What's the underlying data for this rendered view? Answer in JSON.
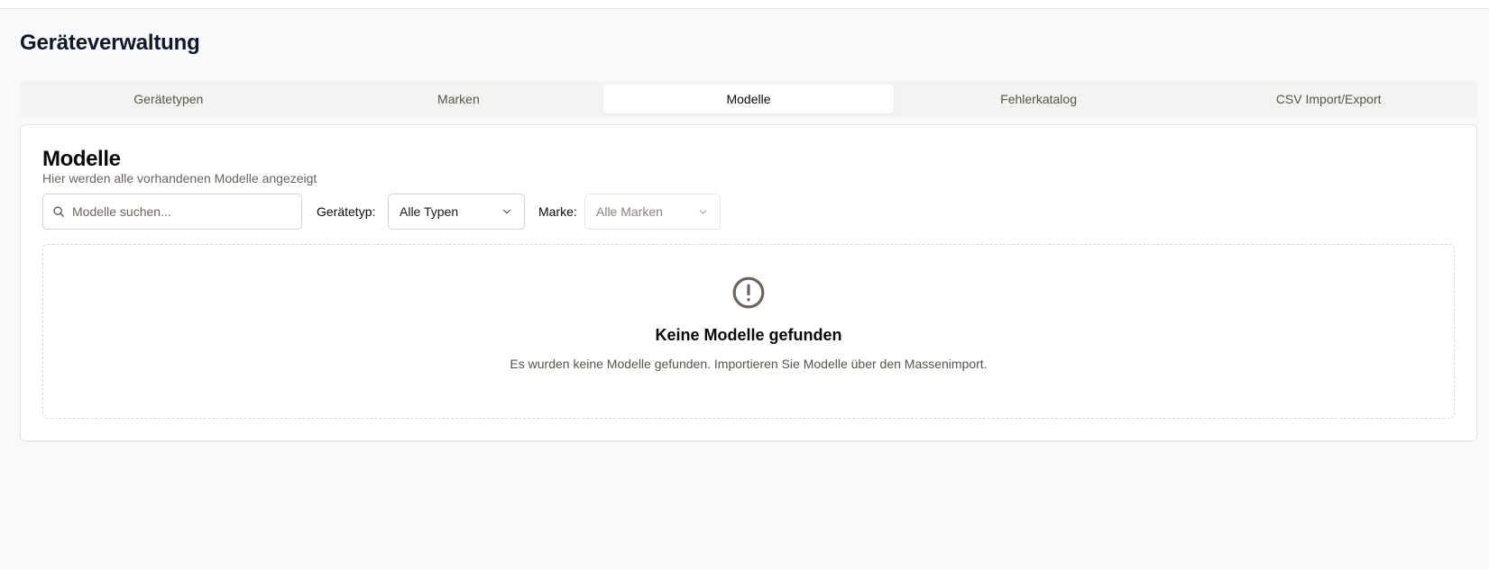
{
  "page": {
    "title": "Geräteverwaltung"
  },
  "tabs": [
    {
      "label": "Gerätetypen",
      "active": false
    },
    {
      "label": "Marken",
      "active": false
    },
    {
      "label": "Modelle",
      "active": true
    },
    {
      "label": "Fehlerkatalog",
      "active": false
    },
    {
      "label": "CSV Import/Export",
      "active": false
    }
  ],
  "card": {
    "title": "Modelle",
    "subtitle": "Hier werden alle vorhandenen Modelle angezeigt"
  },
  "search": {
    "placeholder": "Modelle suchen...",
    "value": "",
    "icon": "search-icon"
  },
  "filters": {
    "type_label": "Gerätetyp:",
    "type_value": "Alle Typen",
    "brand_label": "Marke:",
    "brand_value": "Alle Marken"
  },
  "empty_state": {
    "icon": "alert-circle-icon",
    "title": "Keine Modelle gefunden",
    "text": "Es wurden keine Modelle gefunden. Importieren Sie Modelle über den Massenimport."
  }
}
